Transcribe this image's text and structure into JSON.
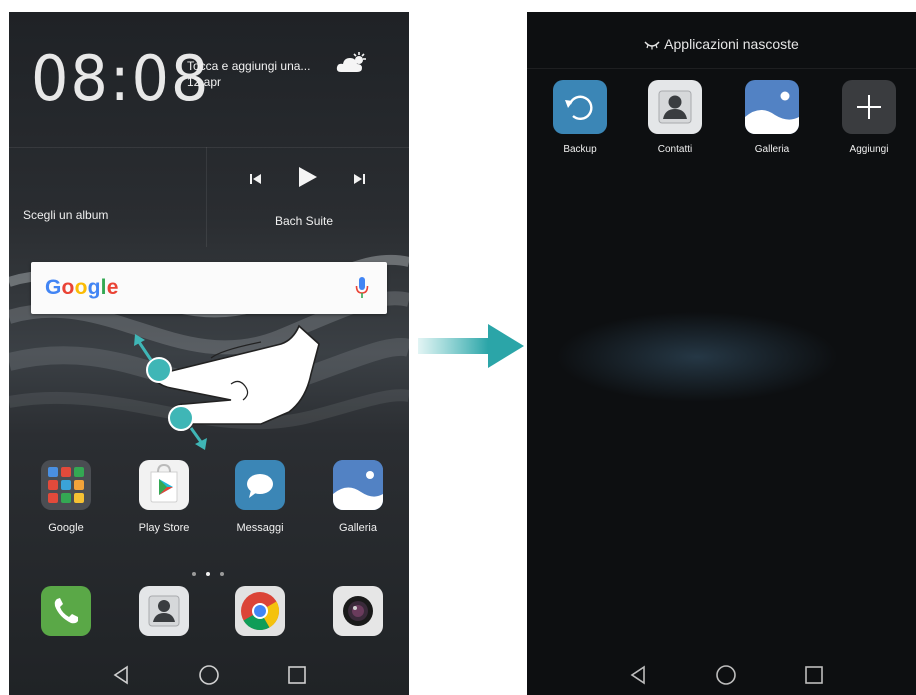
{
  "left_screen": {
    "clock": "08:08",
    "weather_line1": "Tocca e aggiungi una...",
    "weather_date": "12 apr",
    "weather_icon": "partly-cloudy-icon",
    "music": {
      "album_label": "Scegli un album",
      "track_label": "Bach Suite",
      "prev_icon": "skip-previous-icon",
      "play_icon": "play-icon",
      "next_icon": "skip-next-icon"
    },
    "search": {
      "logo": "Google",
      "mic_icon": "microphone-icon"
    },
    "gesture_icon": "pinch-out-gesture-icon",
    "apps": [
      {
        "name": "Google",
        "icon": "google-folder-icon"
      },
      {
        "name": "Play Store",
        "icon": "play-store-icon"
      },
      {
        "name": "Messaggi",
        "icon": "messages-icon"
      },
      {
        "name": "Galleria",
        "icon": "gallery-icon"
      }
    ],
    "dock": [
      {
        "icon": "phone-icon"
      },
      {
        "icon": "contacts-icon"
      },
      {
        "icon": "chrome-icon"
      },
      {
        "icon": "camera-icon"
      }
    ],
    "page_dots": 3,
    "active_page": 2
  },
  "transition_arrow_icon": "arrow-right-icon",
  "right_screen": {
    "title": "Applicazioni nascoste",
    "title_icon": "hidden-eye-icon",
    "apps": [
      {
        "name": "Backup",
        "icon": "backup-icon"
      },
      {
        "name": "Contatti",
        "icon": "contacts-icon"
      },
      {
        "name": "Galleria",
        "icon": "gallery-icon"
      },
      {
        "name": "Aggiungi",
        "icon": "add-icon"
      }
    ]
  },
  "navbar": {
    "back_icon": "back-triangle-icon",
    "home_icon": "home-circle-icon",
    "recents_icon": "recents-square-icon"
  },
  "colors": {
    "teal_accent": "#3fb6b6",
    "messages_blue": "#3b86b6",
    "phone_green": "#5aa847"
  }
}
